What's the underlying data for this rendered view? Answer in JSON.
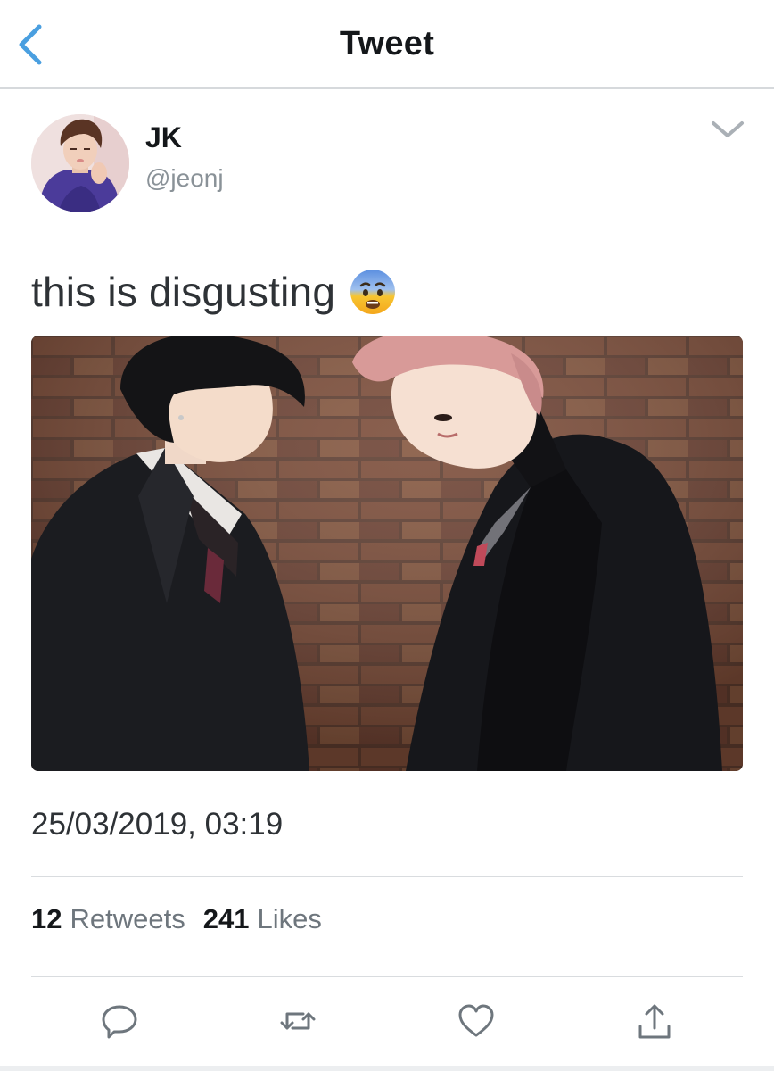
{
  "header": {
    "title": "Tweet",
    "back_icon": "chevron-left-icon",
    "accent_color": "#4a9fe0"
  },
  "author": {
    "name": "JK",
    "handle": "@jeonj"
  },
  "tweet": {
    "text": "this is disgusting",
    "emoji": "fearful-face-emoji",
    "timestamp": "25/03/2019, 03:19"
  },
  "stats": {
    "retweets_count": "12",
    "retweets_label": "Retweets",
    "likes_count": "241",
    "likes_label": "Likes"
  },
  "actions": [
    "reply-icon",
    "retweet-icon",
    "like-icon",
    "share-icon"
  ]
}
